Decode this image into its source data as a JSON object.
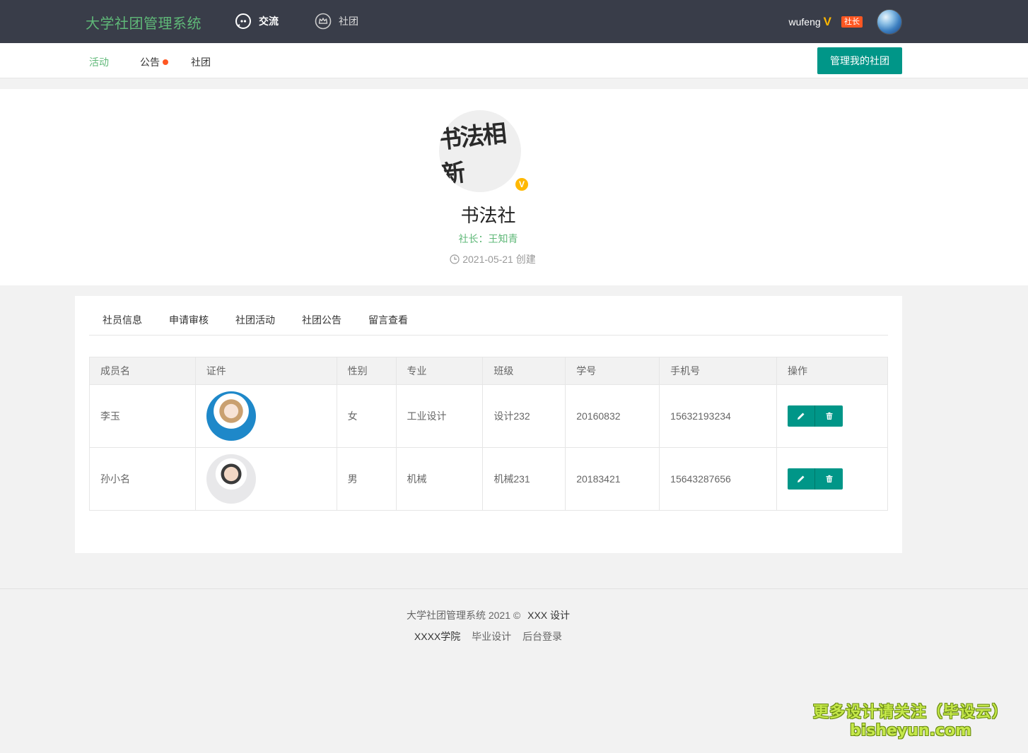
{
  "header": {
    "logo": "大学社团管理系统",
    "nav": [
      {
        "label": "交流",
        "icon": "chat-icon"
      },
      {
        "label": "社团",
        "icon": "crown-icon"
      }
    ],
    "user": {
      "name": "wufeng",
      "vip_mark": "V",
      "role": "社长"
    }
  },
  "subnav": {
    "items": [
      {
        "label": "活动",
        "active": true
      },
      {
        "label": "公告",
        "has_dot": true
      },
      {
        "label": "社团"
      }
    ],
    "manage_button": "管理我的社团"
  },
  "club": {
    "logo_text": "书法相新",
    "verified_mark": "V",
    "name": "书法社",
    "leader": "社长：王知青",
    "created": "2021-05-21 创建"
  },
  "tabs": [
    "社员信息",
    "申请审核",
    "社团活动",
    "社团公告",
    "留言查看"
  ],
  "table": {
    "columns": [
      "成员名",
      "证件",
      "性别",
      "专业",
      "班级",
      "学号",
      "手机号",
      "操作"
    ],
    "rows": [
      {
        "name": "李玉",
        "gender": "女",
        "major": "工业设计",
        "class": "设计232",
        "student_id": "20160832",
        "phone": "15632193234"
      },
      {
        "name": "孙小名",
        "gender": "男",
        "major": "机械",
        "class": "机械231",
        "student_id": "20183421",
        "phone": "15643287656"
      }
    ]
  },
  "footer": {
    "system": "大学社团管理系统",
    "copyright": "2021 ©",
    "designer": "XXX 设计",
    "links": [
      "XXXX学院",
      "毕业设计",
      "后台登录"
    ]
  },
  "watermark": {
    "line1": "更多设计请关注（毕设云）",
    "line2": "bisheyun.com"
  },
  "colors": {
    "primary": "#009688",
    "green": "#5fb878",
    "header_bg": "#393d49",
    "badge": "#ff5722",
    "gold": "#ffb800"
  }
}
